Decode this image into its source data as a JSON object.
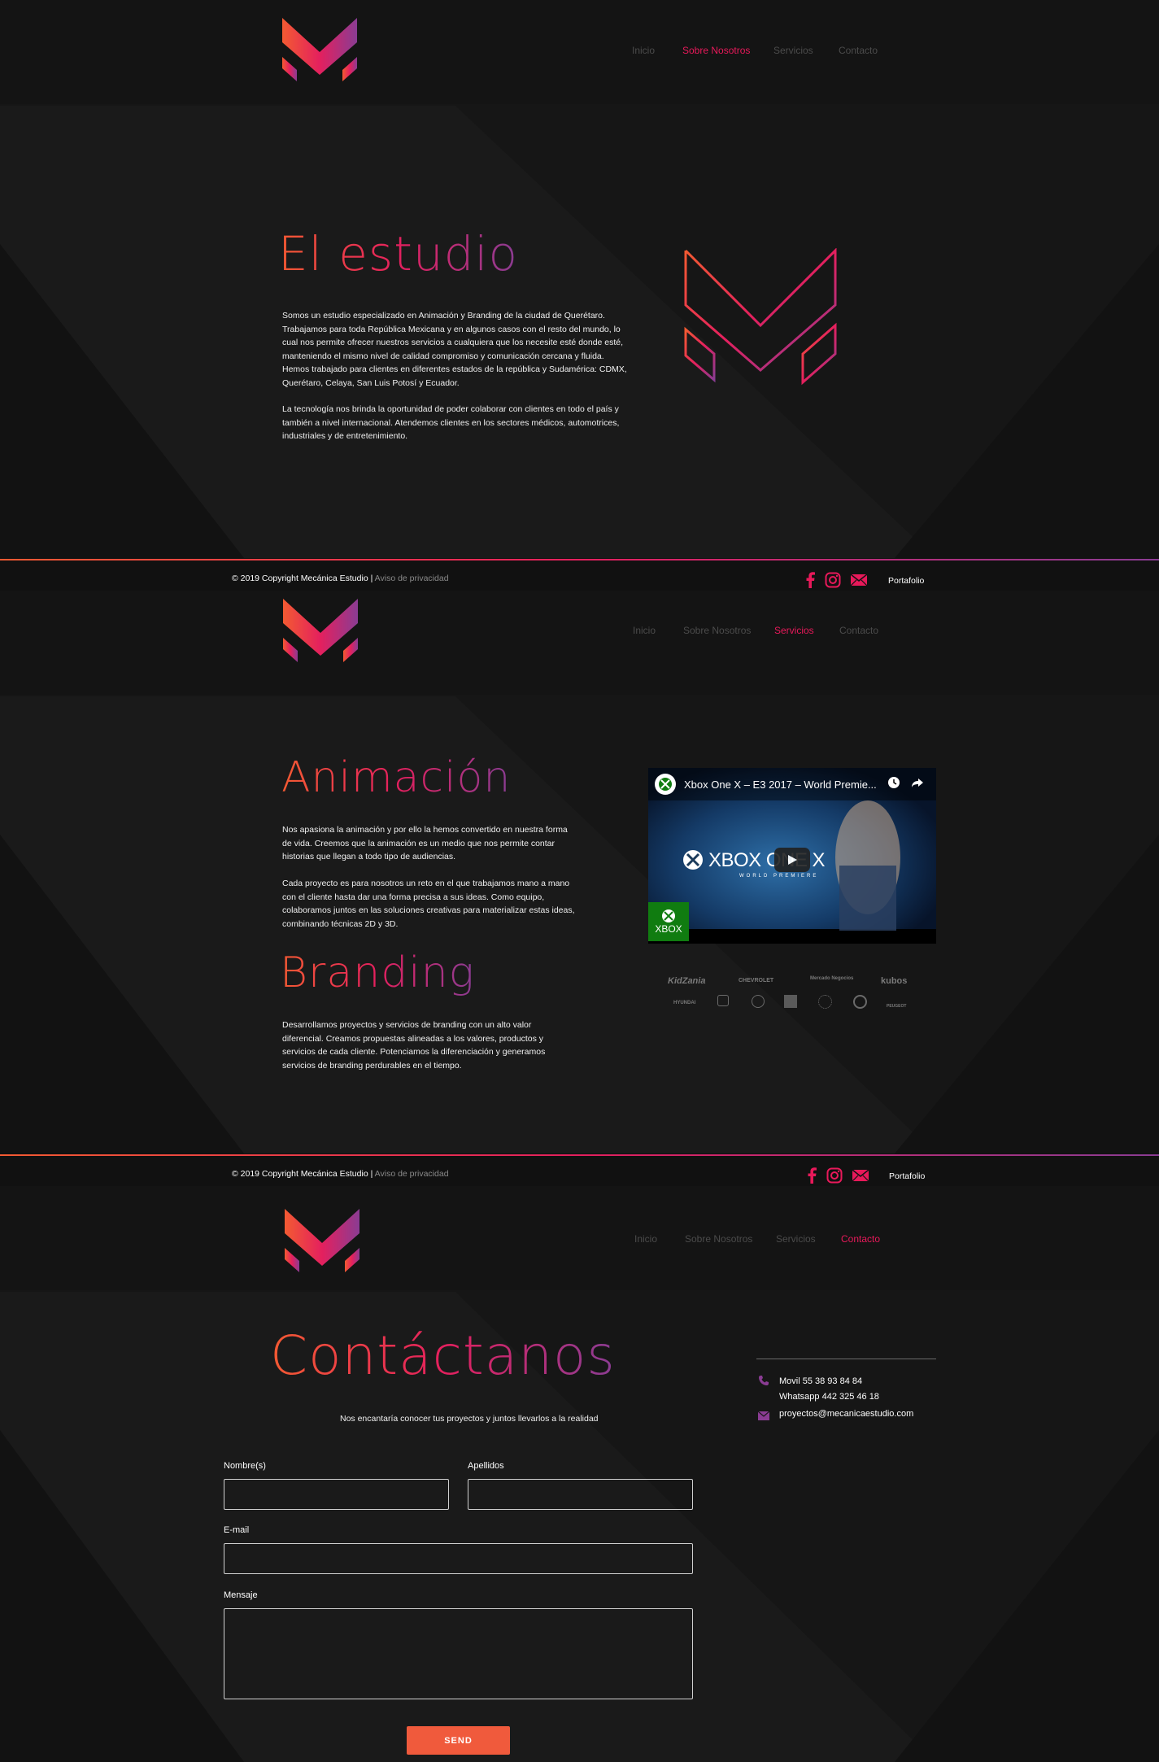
{
  "colors": {
    "accent": "#e8195a",
    "gradient_start": "#f35a32",
    "gradient_mid": "#e4205e",
    "gradient_end": "#8a3c93",
    "button": "#f05a3c",
    "background": "#161616"
  },
  "nav": {
    "items": [
      "Inicio",
      "Sobre Nosotros",
      "Servicios",
      "Contacto"
    ]
  },
  "about": {
    "title": "El estudio",
    "paragraph1": "Somos un estudio especializado en Animación y Branding de la ciudad de Querétaro.  Trabajamos para toda República Mexicana y en algunos casos con el resto del mundo, lo cual nos permite ofrecer nuestros servicios a cualquiera que los necesite esté donde esté, manteniendo el mismo nivel de calidad compromiso y comunicación cercana y fluida.   Hemos trabajado para clientes en diferentes estados de la república y Sudamérica: CDMX, Querétaro, Celaya, San Luis Potosí y Ecuador.",
    "paragraph2": "La tecnología nos brinda la oportunidad de poder colaborar con clientes en todo el país y también a nivel internacional.   Atendemos clientes en los sectores médicos, automotrices, industriales y de entretenimiento."
  },
  "footer": {
    "copyright": "© 2019 Copyright Mecánica Estudio",
    "separator": "|",
    "privacy": "Aviso de privacidad",
    "portfolio": "Portafolio",
    "social_icons": [
      "facebook-icon",
      "instagram-icon",
      "mail-icon"
    ]
  },
  "services": {
    "animation_title": "Animación",
    "animation_p1": "Nos apasiona la animación y por ello la hemos convertido en nuestra forma de vida. Creemos que la animación es un medio que nos permite contar historias que llegan a todo tipo de audiencias.",
    "animation_p2": "Cada proyecto es para nosotros un reto en el que trabajamos mano a mano con el cliente hasta dar una forma precisa a sus ideas. Como equipo, colaboramos juntos en las soluciones creativas para materializar estas ideas, combinando técnicas 2D y 3D.",
    "branding_title": "Branding",
    "branding_p": "Desarrollamos proyectos y servicios de branding con un alto valor diferencial. Creamos propuestas alineadas a los valores, productos y servicios de cada cliente. Potenciamos la diferenciación y generamos servicios de branding perdurables en el tiempo.",
    "video": {
      "title": "Xbox One X – E3 2017 – World Premie...",
      "overlay": "XBOX ONE X",
      "overlay_sub": "WORLD PREMIERE",
      "badge": "XBOX"
    },
    "clients_row1": [
      "KidZania",
      "CHEVROLET",
      "Mercado Negocios",
      "kubos"
    ],
    "clients_row2": [
      "HYUNDAI",
      "",
      "",
      "",
      "",
      "",
      "PEUGEOT"
    ]
  },
  "contact": {
    "title": "Contáctanos",
    "subtitle": "Nos encantaría conocer tus proyectos y juntos llevarlos a la realidad",
    "labels": {
      "name": "Nombre(s)",
      "surname": "Apellidos",
      "email": "E-mail",
      "message": "Mensaje"
    },
    "send": "SEND",
    "movil": "Movil 55 38 93 84 84",
    "whatsapp": "Whatsapp 442 325 46 18",
    "email": "proyectos@mecanicaestudio.com"
  }
}
